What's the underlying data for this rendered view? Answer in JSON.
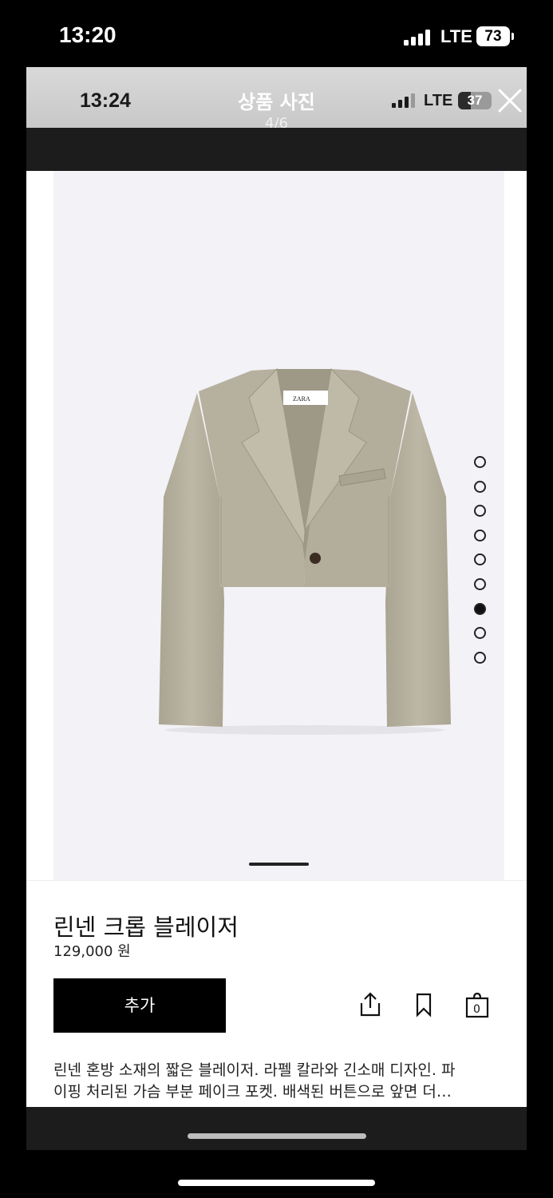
{
  "outer_status": {
    "time": "13:20",
    "network": "LTE",
    "battery": "73"
  },
  "inner_status": {
    "time": "13:24",
    "network": "LTE",
    "battery": "37",
    "battery_level": 0.37
  },
  "viewer": {
    "title": "상품 사진",
    "counter": "4/6",
    "close_icon": "close-icon"
  },
  "image": {
    "brand_tag": "ZARA",
    "dots_total": 9,
    "active_dot": 7
  },
  "product": {
    "name": "린넨 크롭 블레이저",
    "price": "129,000 원",
    "add_label": "추가",
    "icons": [
      "share-icon",
      "bookmark-icon",
      "bag-icon"
    ],
    "bag_count": "0",
    "description_line1": "린넨 혼방 소재의 짧은 블레이저. 라펠 칼라와 긴소매 디자인. 파",
    "description_line2": "이핑 처리된 가슴 부분 페이크 포켓. 배색된 버튼으로 앞면 더…"
  },
  "colors": {
    "jacket": "#b9b3a2",
    "image_bg": "#f3f2f6",
    "button": "#000000"
  }
}
